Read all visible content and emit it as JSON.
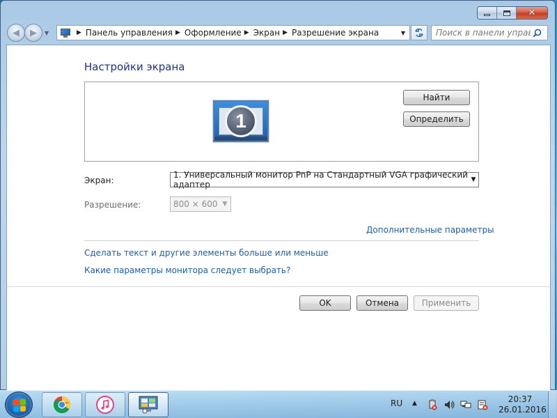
{
  "window": {
    "caption_buttons": {
      "minimize": "minimize",
      "maximize": "maximize",
      "close": "✕"
    }
  },
  "nav": {
    "back_glyph": "◀",
    "forward_glyph": "▶",
    "breadcrumbs": [
      "Панель управления",
      "Оформление",
      "Экран",
      "Разрешение экрана"
    ],
    "search_placeholder": "Поиск в панели управ..."
  },
  "content": {
    "title": "Настройки экрана",
    "monitor_number": "1",
    "find_button": "Найти",
    "identify_button": "Определить",
    "screen_label": "Экран:",
    "screen_value": "1. Универсальный монитор PnP на Стандартный VGA графический адаптер",
    "resolution_label": "Разрешение:",
    "resolution_value": "800 × 600",
    "advanced_link": "Дополнительные параметры",
    "text_size_link": "Сделать текст и другие элементы больше или меньше",
    "which_settings_link": "Какие параметры монитора следует выбрать?",
    "ok_button": "OK",
    "cancel_button": "Отмена",
    "apply_button": "Применить"
  },
  "taskbar": {
    "language": "RU",
    "time": "20:37",
    "date": "26.01.2016",
    "pinned": [
      "windows-start",
      "chrome",
      "itunes",
      "control-panel"
    ]
  },
  "colors": {
    "link": "#1b5fa8",
    "title": "#1e3287"
  }
}
